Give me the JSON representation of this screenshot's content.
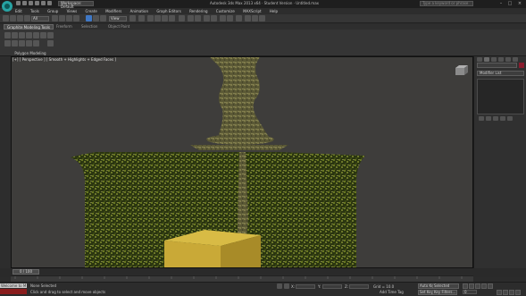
{
  "window": {
    "title": "Autodesk 3ds Max 2013 x64 · Student Version · Untitled.max",
    "workspace": "Workspace: Default",
    "search_placeholder": "Type a keyword or phrase"
  },
  "menu": [
    "Edit",
    "Tools",
    "Group",
    "Views",
    "Create",
    "Modifiers",
    "Animation",
    "Graph Editors",
    "Rendering",
    "Customize",
    "MAXScript",
    "Help"
  ],
  "toolbar": {
    "selection_filter": "All",
    "coord_system": "View"
  },
  "ribbon": {
    "tabs": [
      "Graphite Modeling Tools",
      "Freeform",
      "Selection",
      "Object Paint"
    ],
    "active_tab": 0,
    "panel_label": "Polygon Modeling"
  },
  "viewport": {
    "label": "[+] [ Perspective ] [ Smooth + Highlights + Edged Faces ]",
    "scene_colors": {
      "background": "#3e3d3b",
      "hedge": "#3a4a12",
      "trunk": "#6b6a40",
      "box": "#c9a937"
    }
  },
  "command_panel": {
    "modifier_list": "Modifier List"
  },
  "time": {
    "slider": "0 / 100",
    "ticks": [
      "0",
      "5",
      "10",
      "15",
      "20",
      "25",
      "30",
      "35",
      "40",
      "45",
      "50",
      "55",
      "60",
      "65",
      "70",
      "75",
      "80",
      "85",
      "90",
      "95",
      "100"
    ]
  },
  "status": {
    "maxscript": "Welcome to M",
    "selection": "None Selected",
    "prompt": "Click and drag to select and move objects",
    "x_label": "X:",
    "x_value": "",
    "y_label": "Y:",
    "y_value": "",
    "z_label": "Z:",
    "z_value": "",
    "grid": "Grid = 10.0",
    "auto_key": "Auto Key",
    "set_key": "Set Key",
    "key_filter": "Selected",
    "key_filters": "Key Filters...",
    "add_time_tag": "Add Time Tag",
    "frame": "0"
  }
}
